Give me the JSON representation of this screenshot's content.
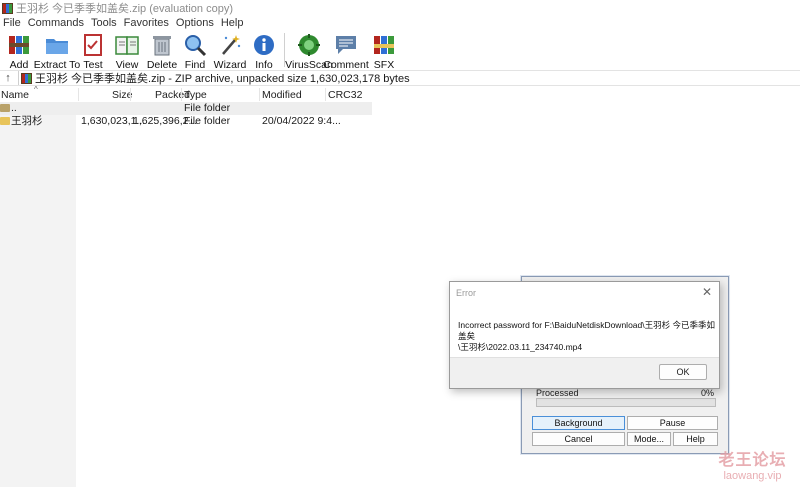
{
  "window": {
    "title": "王羽杉 今已季季如盖矣.zip (evaluation copy)"
  },
  "menu": [
    "File",
    "Commands",
    "Tools",
    "Favorites",
    "Options",
    "Help"
  ],
  "toolbar": {
    "add": "Add",
    "extract_to": "Extract To",
    "test": "Test",
    "view": "View",
    "delete": "Delete",
    "find": "Find",
    "wizard": "Wizard",
    "info": "Info",
    "virusscan": "VirusScan",
    "comment": "Comment",
    "sfx": "SFX"
  },
  "address": {
    "path": "王羽杉 今已季季如盖矣.zip - ZIP archive, unpacked size 1,630,023,178 bytes"
  },
  "columns": {
    "name": "Name",
    "size": "Size",
    "packed": "Packed",
    "type": "Type",
    "modified": "Modified",
    "crc32": "CRC32"
  },
  "rows": [
    {
      "name": "..",
      "size": "",
      "packed": "",
      "type": "File folder",
      "modified": "",
      "crc": ""
    },
    {
      "name": "王羽杉",
      "size": "1,630,023,1...",
      "packed": "1,625,396,2...",
      "type": "File folder",
      "modified": "20/04/2022 9:4...",
      "crc": ""
    }
  ],
  "progress_dialog": {
    "processed_label": "Processed",
    "processed_pct": "0%",
    "progress": 0,
    "buttons": {
      "background": "Background",
      "pause": "Pause",
      "cancel": "Cancel",
      "mode": "Mode...",
      "help": "Help"
    }
  },
  "error_dialog": {
    "title": "Error",
    "close": "✕",
    "line1": "Incorrect password for F:\\BaiduNetdiskDownload\\王羽杉 今已季季如盖矣",
    "line2": "\\王羽杉\\2022.03.11_234740.mp4",
    "ok": "OK"
  },
  "watermark": {
    "main": "老王论坛",
    "sub": "laowang.vip"
  },
  "colors": {
    "progress_fill": "#06b025",
    "focus_border": "#4a8fd8",
    "watermark": "#e5a1a6"
  }
}
